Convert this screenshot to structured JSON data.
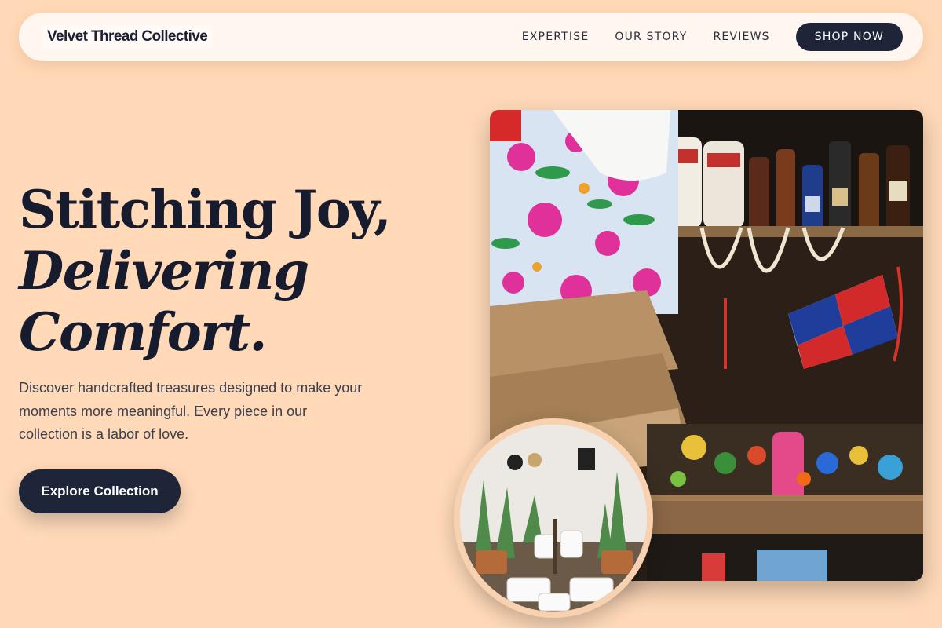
{
  "nav": {
    "brand": "Velvet Thread Collective",
    "links": [
      "EXPERTISE",
      "OUR STORY",
      "REVIEWS"
    ],
    "shop_label": "SHOP NOW"
  },
  "hero": {
    "line1": "Stitching Joy,",
    "line2": "Delivering",
    "line3": "Comfort.",
    "description": "Discover handcrafted treasures designed to make your moments more meaningful. Every piece in our collection is a labor of love.",
    "cta_label": "Explore Collection"
  },
  "images": {
    "main_alt": "Colorful market stall with floral textiles, shell necklaces, flags and bottles",
    "circle_alt": "Boutique shop interior with plants, mugs and hanging decor"
  },
  "colors": {
    "background": "#ffd9b8",
    "navy": "#1e2538",
    "nav_bg": "#fff6f0"
  }
}
